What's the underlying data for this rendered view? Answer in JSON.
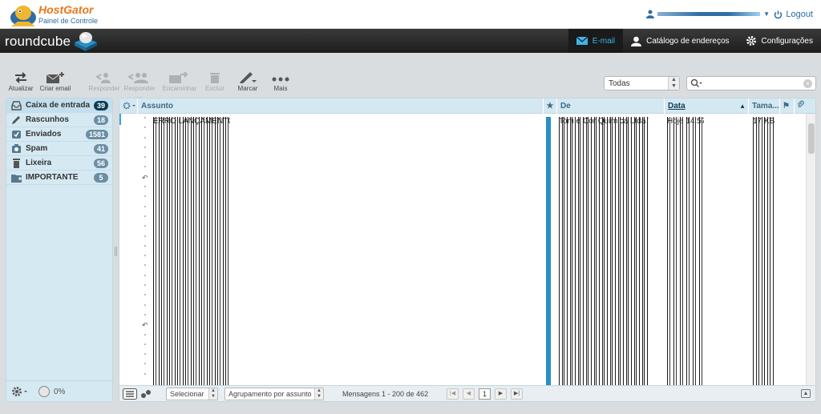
{
  "hostgator": {
    "brand": "HostGator",
    "subtitle": "Painel de Controle",
    "logout": "Logout"
  },
  "app": {
    "logo": "roundcube"
  },
  "nav": {
    "email": "E-mail",
    "contacts": "Catálogo de endereços",
    "settings": "Configurações"
  },
  "toolbar": {
    "refresh": "Atualizar",
    "compose": "Criar email",
    "reply": "Responder",
    "reply_all": "Responder ...",
    "forward": "Encaminhar",
    "delete": "Excluir",
    "mark": "Marcar",
    "more": "Mais"
  },
  "filter": {
    "selected": "Todas"
  },
  "search": {
    "value": ""
  },
  "folders": [
    {
      "label": "Caixa de entrada",
      "count": "39",
      "icon": "inbox-icon"
    },
    {
      "label": "Rascunhos",
      "count": "18",
      "icon": "pencil-icon"
    },
    {
      "label": "Enviados",
      "count": "1581",
      "icon": "sent-icon"
    },
    {
      "label": "Spam",
      "count": "41",
      "icon": "spam-icon"
    },
    {
      "label": "Lixeira",
      "count": "56",
      "icon": "trash-icon"
    },
    {
      "label": "IMPORTANTE",
      "count": "5",
      "icon": "folder-icon"
    }
  ],
  "quota": {
    "percent": "0%"
  },
  "list": {
    "columns": {
      "subject": "Assunto",
      "from": "De",
      "date": "Data",
      "size": "Tama..."
    },
    "first_row": {
      "subject": "ERRO LANÇAMENTO",
      "from": "Tom e Cor Química Ltda To",
      "date": "Hoje 14:57",
      "size": "17 KB"
    },
    "reply_rows": [
      6,
      21
    ]
  },
  "footer": {
    "select": "Selecionar",
    "threads": "Agrupamento por assunto",
    "count": "Mensagens 1 - 200 de 462",
    "page": "1"
  },
  "colors": {
    "accent": "#3fb3e8",
    "header_bg": "#1d1d1d",
    "folder_bg": "#d5e9f3"
  }
}
